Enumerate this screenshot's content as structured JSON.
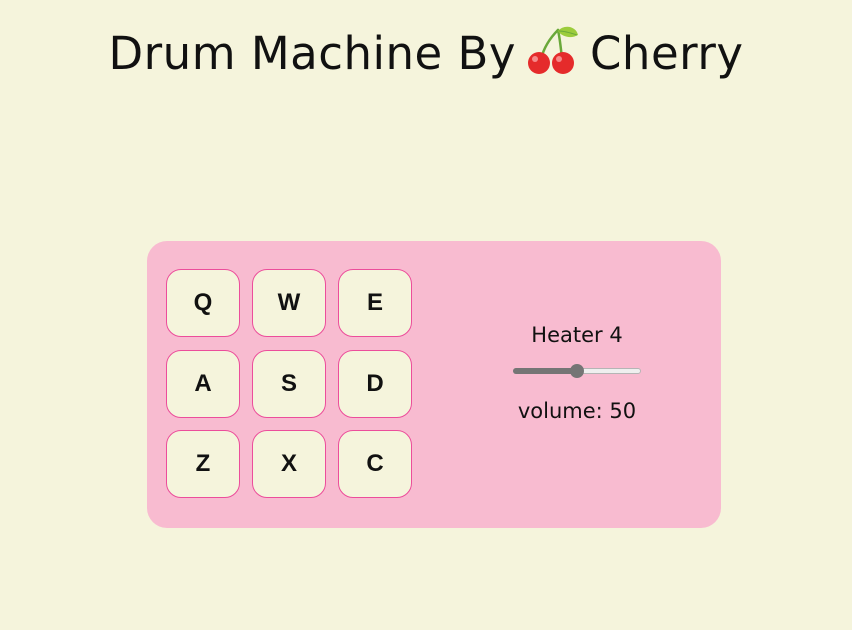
{
  "header": {
    "title_prefix": "Drum Machine By",
    "title_suffix": "Cherry",
    "title_icon": "cherry-emoji"
  },
  "drum_pads": [
    {
      "key": "Q"
    },
    {
      "key": "W"
    },
    {
      "key": "E"
    },
    {
      "key": "A"
    },
    {
      "key": "S"
    },
    {
      "key": "D"
    },
    {
      "key": "Z"
    },
    {
      "key": "X"
    },
    {
      "key": "C"
    }
  ],
  "controls": {
    "display_text": "Heater 4",
    "volume_value": 50,
    "volume_min": 0,
    "volume_max": 100,
    "volume_label": "volume: 50"
  },
  "colors": {
    "background": "#f5f4dc",
    "machine_panel": "#f8bbd0",
    "pad_border": "#ec4d9b",
    "cherry_red": "#e52b2b",
    "leaf_green": "#7cc24a"
  }
}
